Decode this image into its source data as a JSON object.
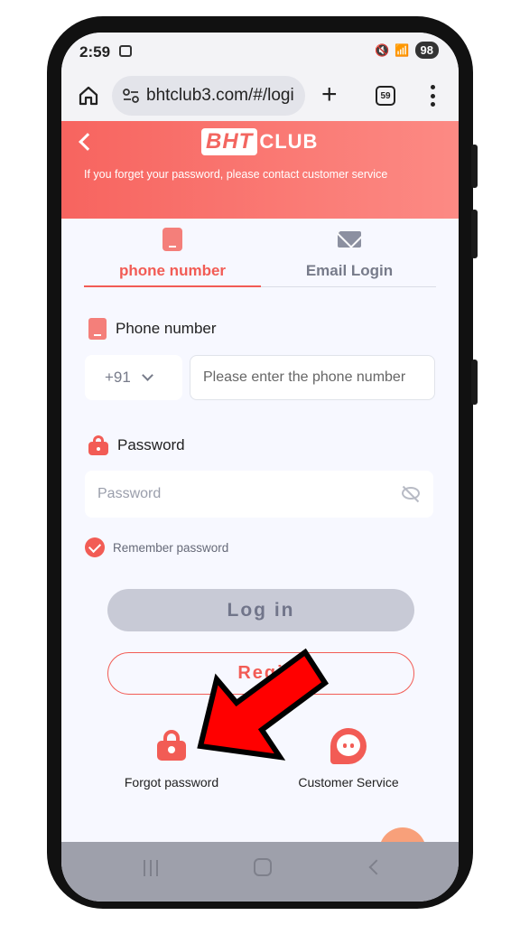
{
  "status_bar": {
    "time": "2:59",
    "battery": "98"
  },
  "browser": {
    "url": "bhtclub3.com/#/logi",
    "tab_count": "59"
  },
  "header": {
    "logo_bht": "BHT",
    "logo_club": "CLUB",
    "notice": "If you forget your password, please contact customer service"
  },
  "tabs": [
    {
      "label": "phone number",
      "active": true,
      "icon": "phone-icon"
    },
    {
      "label": "Email Login",
      "active": false,
      "icon": "mail-icon"
    }
  ],
  "form": {
    "phone_label": "Phone number",
    "country_code": "+91",
    "phone_placeholder": "Please enter the phone number",
    "password_label": "Password",
    "password_placeholder": "Password",
    "remember_label": "Remember password",
    "remember_checked": true
  },
  "buttons": {
    "login": "Log in",
    "register": "Regi"
  },
  "footer_links": {
    "forgot": "Forgot password",
    "customer_service": "Customer Service"
  },
  "colors": {
    "accent": "#f25c55",
    "header_start": "#f7645f",
    "header_end": "#fc8a84",
    "annotation_arrow": "#ff0000"
  }
}
